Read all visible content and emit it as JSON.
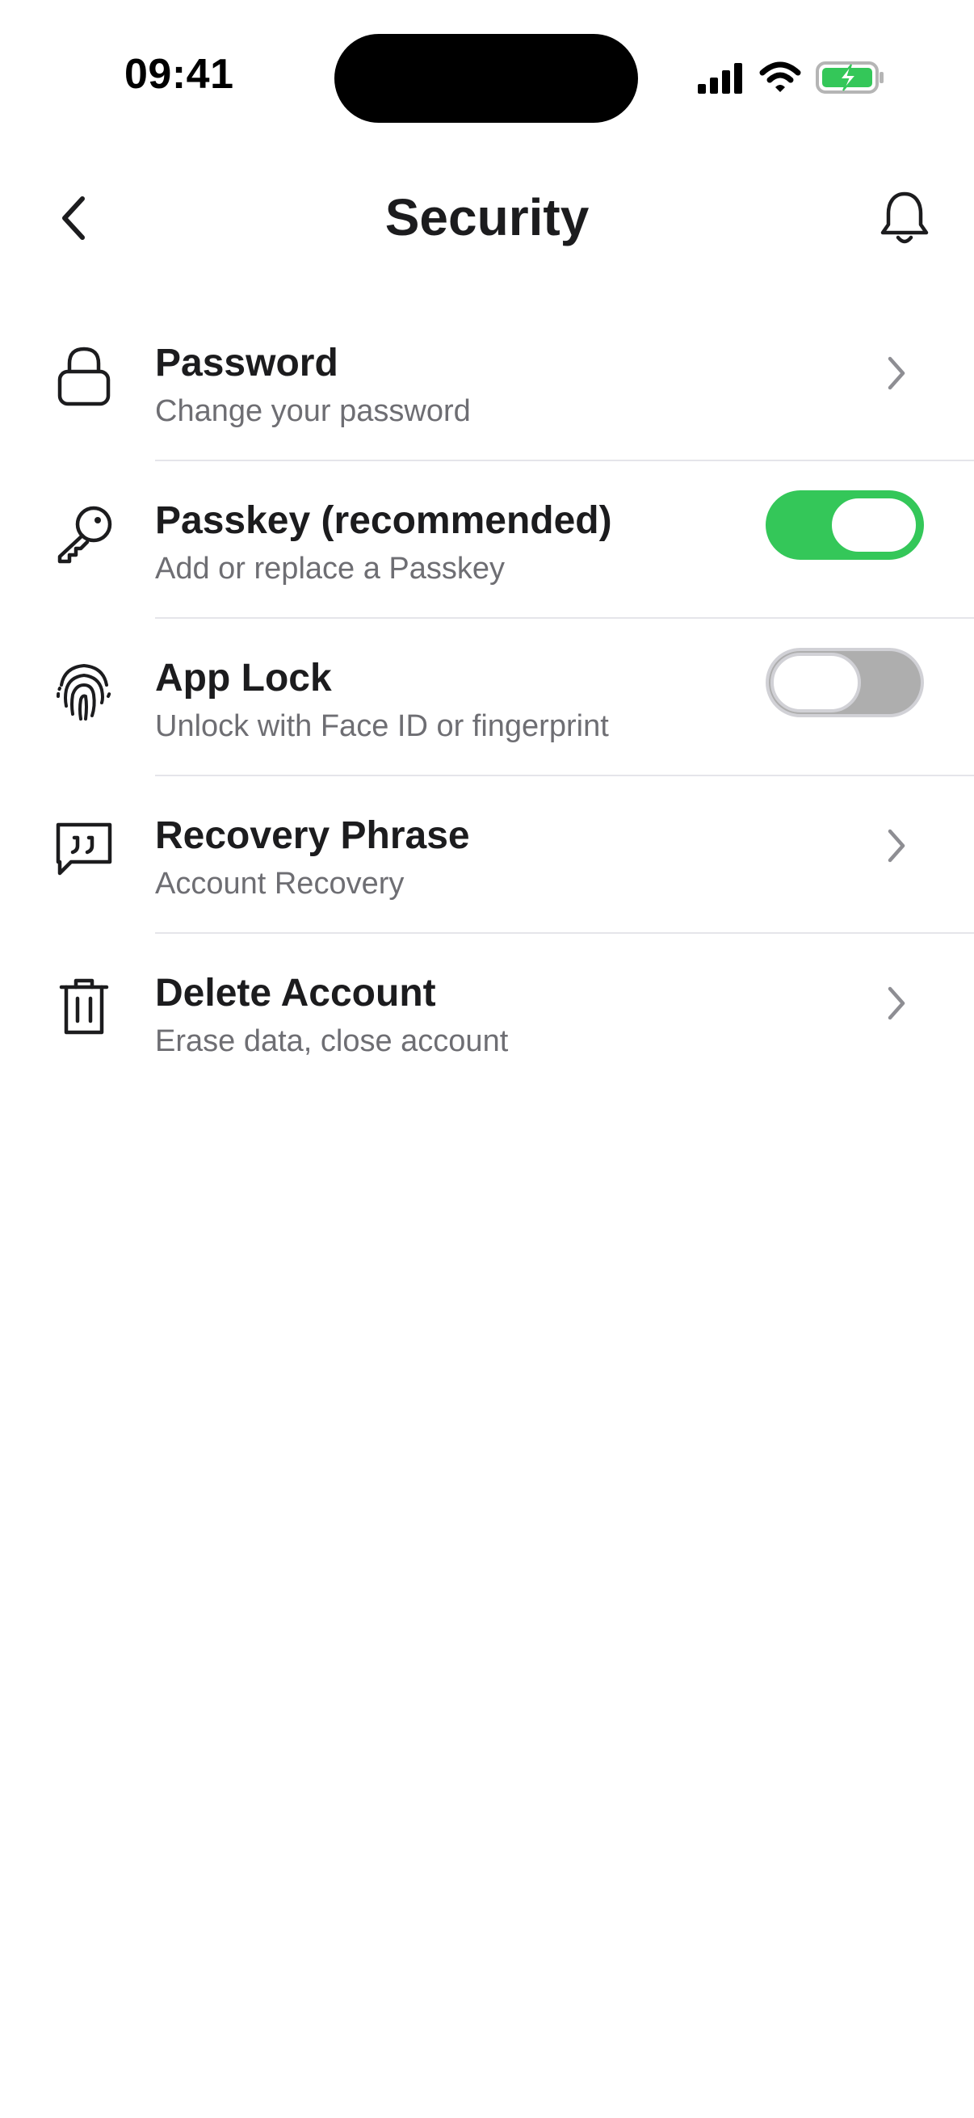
{
  "status_bar": {
    "time": "09:41",
    "battery_color": "#34c759"
  },
  "header": {
    "title": "Security",
    "back_icon": "chevron-left-icon",
    "notification_icon": "bell-icon"
  },
  "settings": [
    {
      "title": "Password",
      "subtitle": "Change your password",
      "icon": "lock-icon",
      "control": "chevron"
    },
    {
      "title": "Passkey (recommended)",
      "subtitle": "Add or replace a Passkey",
      "icon": "key-icon",
      "control": "toggle",
      "enabled": true
    },
    {
      "title": "App Lock",
      "subtitle": "Unlock with Face ID or fingerprint",
      "icon": "fingerprint-icon",
      "control": "toggle",
      "enabled": false
    },
    {
      "title": "Recovery Phrase",
      "subtitle": "Account Recovery",
      "icon": "quote-message-icon",
      "control": "chevron"
    },
    {
      "title": "Delete Account",
      "subtitle": "Erase data, close account",
      "icon": "trash-icon",
      "control": "chevron"
    }
  ],
  "colors": {
    "accent_green": "#34c759",
    "toggle_off": "#aeaeae",
    "subtitle_gray": "#6e6e73"
  }
}
